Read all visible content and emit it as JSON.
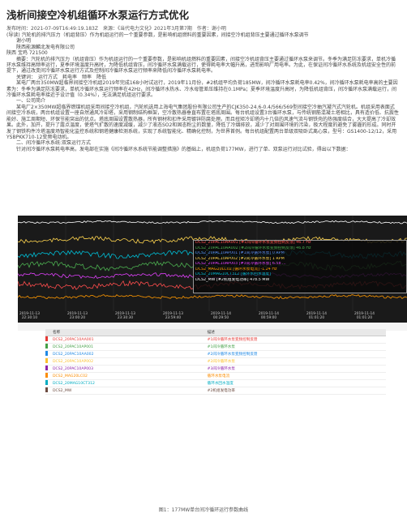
{
  "header": {
    "title": "浅析间接空冷机组循环水泵运行方式优化",
    "meta": "发布时间：2021-07-09T16:49:19.183Z　来源：《当代电力文化》2021年3月第7期　作者：谢小明"
  },
  "body": [
    {
      "indent": false,
      "text": "(导读) 汽轮机的排汽压力（机组背压）作为机组运行的一个重要参数，是影响机组燃料的重要因素，间接空冷机组背压主要通过循环水泵调节"
    },
    {
      "indent": false,
      "text": "　　谢小明"
    },
    {
      "indent": false,
      "text": "　　陕西能源麟北发电有限公司"
    },
    {
      "indent": false,
      "text": "陕西 宝鸡 721500"
    },
    {
      "indent": true,
      "text": "摘要：汽轮机的排汽压力（机组背压）作为机组运行的一个重要参数，是影响机组燃料的重要因素，间接空冷机组背压主要通过循环水泵来调节。冬季为满足防冻要求，单机冷循环水泵维持高频率运行，夏季环境温度升高时，为降低机组背压，间冷循环水泵满载运行，使得耗电率大幅升高，进而影响厂用电率。为此，在保证间冷循环水系统及机组安全性的前提下，通过改变间冷循环水泵运行方式及控制间冷循环水泵运行频率来降低间冷循环水泵耗电率。"
    },
    {
      "indent": true,
      "text": "关键词：　运行方式　耗电率　频率　降低"
    },
    {
      "indent": true,
      "text": "某电厂两台350MW超临界间接空冷机组2019年完成168小时试运行，2019年11月份，#2机组平均负荷185MW，间冷循环水泵耗电率0.42%，间冷循环水泵耗电率高的主要因素为：冬季为满足防冻要求，单机冷循环水泵运行频率在42Hz，间冷循环水热水、冷水母管差压维持在0.1MPa；夏季环境温度升高时，为降低机组背压，间冷循环水泵满载运行，间冷循环水泵耗电率接近于设计值（0.34%），无法满足机组运行要求。"
    },
    {
      "indent": true,
      "text": "一、公司简介"
    },
    {
      "indent": true,
      "text": "某电厂2×350MW超临界燃煤机组采用间接空冷机组，汽轮机选用上海电气集团股份有限公司生产的CJK350-24.6-0.4/566/569型间接空冷抽汽凝汽式汽轮机。机组采用表面式间接空冷系统，两台机组设置一座自然通风冷却塔，采用钢制结构框架，空冷散热器垂直布置在塔底周围。每台机组设置3台循环水泵，与传统钢筋混凝土塔相比，具有造价低、抗震性能好、施工周期短、环保节能突出的优点。塔底周围设置散热器，所有钢材和扣件采用镀锌防腐处理。而且扭矩冷却塔内十几倍的风速气流与钢铁壳的热强度结合，大大提高了冷却效果。此外，加开，提升了露点温度，使塔气扩散的速度减缓，减少了液态SO2和固态粉尘的数量，降低了冷烟排放，减少了对周围环境的污染，极大程度的避免了雾霾的形成。同时开发了钢铁构件冷塔温度场智能化监控系统和钢塔健康检测系统，实现了系统智能化、精确化控制，为世界首例。每台机组配置两台单级双吸卧式离心泵，型号：GS1400-12/12，采用YSBPKK710-12变频电动机。"
    },
    {
      "indent": true,
      "text": "二、间冷循环水系统:双泵运行方式"
    },
    {
      "indent": true,
      "text": "针对间冷循环水泵耗电率高，发电部在实施《间冷循环水系统节能调整措施》的基础上，机组负荷177MW，进行了单、双泵运行对比试验，得出以下数据："
    }
  ],
  "trend": {
    "legend": [
      {
        "text": "DCS2_20PAC10AA001  [#1间冷循环水泵变频控制反馈]  46.7 Hz",
        "color": "#ff4d4d"
      },
      {
        "text": "DCS2_20PAC10AA002  [#2间冷循环水泵变频控制反馈]  46.8 Hz",
        "color": "#4caf50"
      },
      {
        "text": "DCS2_20PAC10AP001  [#1间冷循环水泵]  0 RPM",
        "color": "#5a8dee"
      },
      {
        "text": "DCS2_20PAC10AP002  [#2间冷循环水泵]  1 RPM",
        "color": "#ffd54f"
      },
      {
        "text": "DCS2_20PAC10AP003  [#3间冷循环水泵]  6.58 ...",
        "color": "#e040fb"
      },
      {
        "text": "DCS2_MAG20LC02  [循环水泵电流]  -1.24 Hz",
        "color": "#ff9800"
      },
      {
        "text": "DCS2_20MAG10CT312  [循环水回水温度]",
        "color": "#00bcd4"
      },
      {
        "text": "DCS2_MW  [#2机组发电功率]  478.5 MW",
        "color": "#ffffff"
      }
    ],
    "ticks": [
      {
        "date": "2019-11-13",
        "time": "22:30:10"
      },
      {
        "date": "2019-11-13",
        "time": "23:00:20"
      },
      {
        "date": "2019-11-13",
        "time": "23:30:30"
      },
      {
        "date": "2019-11-13",
        "time": "23:59:40"
      },
      {
        "date": "2019-11-14",
        "time": "00:29:50"
      },
      {
        "date": "2019-11-14",
        "time": "00:59:00"
      },
      {
        "date": "2019-11-14",
        "time": "01:01:20"
      },
      {
        "date": "2019-11-14",
        "time": "01:01:20"
      }
    ]
  },
  "table": {
    "headers": [
      "名称",
      "描述"
    ],
    "rows": [
      {
        "name": "DCS2_20PAC10AA001",
        "desc": "#1间冷循环水泵变频控制反馈",
        "color": "#e53935"
      },
      {
        "name": "DCS2_20PAC10AP001",
        "desc": "#1间冷循环水泵",
        "color": "#43a047"
      },
      {
        "name": "DCS2_20PAC10AA002",
        "desc": "#2间冷循环水泵变频控制反馈",
        "color": "#1e88e5"
      },
      {
        "name": "DCS2_20PAC10AP002",
        "desc": "#2间冷循环水泵",
        "color": "#fbc02d"
      },
      {
        "name": "DCS2_20PAC10AP003",
        "desc": "#3间冷循环水泵",
        "color": "#8e24aa"
      },
      {
        "name": "DCS2_MAG20LC02",
        "desc": "循环水泵电流",
        "color": "#fb8c00"
      },
      {
        "name": "DCS2_20MAG10CT312",
        "desc": "循环水回水温度",
        "color": "#00acc1"
      },
      {
        "name": "DCS2_MW",
        "desc": "#2机组发电功率",
        "color": "#6d4c41"
      }
    ]
  },
  "caption": "图1：177MW单台间冷循环运行参数曲线"
}
